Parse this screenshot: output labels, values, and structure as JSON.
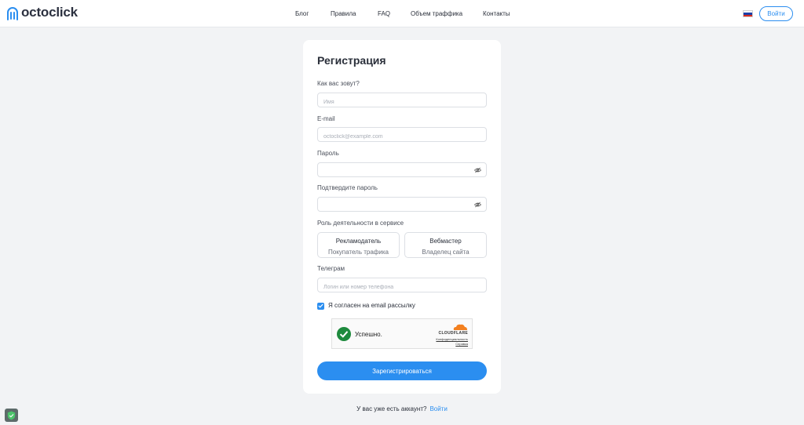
{
  "header": {
    "logo_text": "octoclick",
    "nav": [
      "Блог",
      "Правила",
      "FAQ",
      "Объем траффика",
      "Контакты"
    ],
    "login_label": "Войти"
  },
  "form": {
    "title": "Регистрация",
    "name_label": "Как вас зовут?",
    "name_placeholder": "Имя",
    "email_label": "E-mail",
    "email_placeholder": "octoclick@example.com",
    "password_label": "Пароль",
    "confirm_label": "Подтвердите пароль",
    "role_label": "Роль деятельности в сервисе",
    "roles": [
      {
        "title": "Рекламодатель",
        "subtitle": "Покупатель трафика"
      },
      {
        "title": "Вебмастер",
        "subtitle": "Владелец сайта"
      }
    ],
    "telegram_label": "Телеграм",
    "telegram_placeholder": "Логин или номер телефона",
    "newsletter_label": "Я согласен на email рассылку",
    "newsletter_checked": true,
    "submit_label": "Зарегистрироваться"
  },
  "captcha": {
    "status": "Успешно.",
    "brand": "CLOUDFLARE",
    "privacy_link": "Конфиденциальность",
    "help_link": "Справка"
  },
  "footer": {
    "question": "У вас уже есть аккаунт?",
    "login_link": "Войти"
  },
  "colors": {
    "accent": "#2b8ef0",
    "page_bg": "#f2f3f5",
    "success": "#1e8a3d",
    "cloudflare_orange": "#f38020"
  },
  "icons": [
    "logo-icon",
    "eye-off-icon",
    "checkmark-icon",
    "cloudflare-icon",
    "shield-icon",
    "russia-flag-icon"
  ]
}
